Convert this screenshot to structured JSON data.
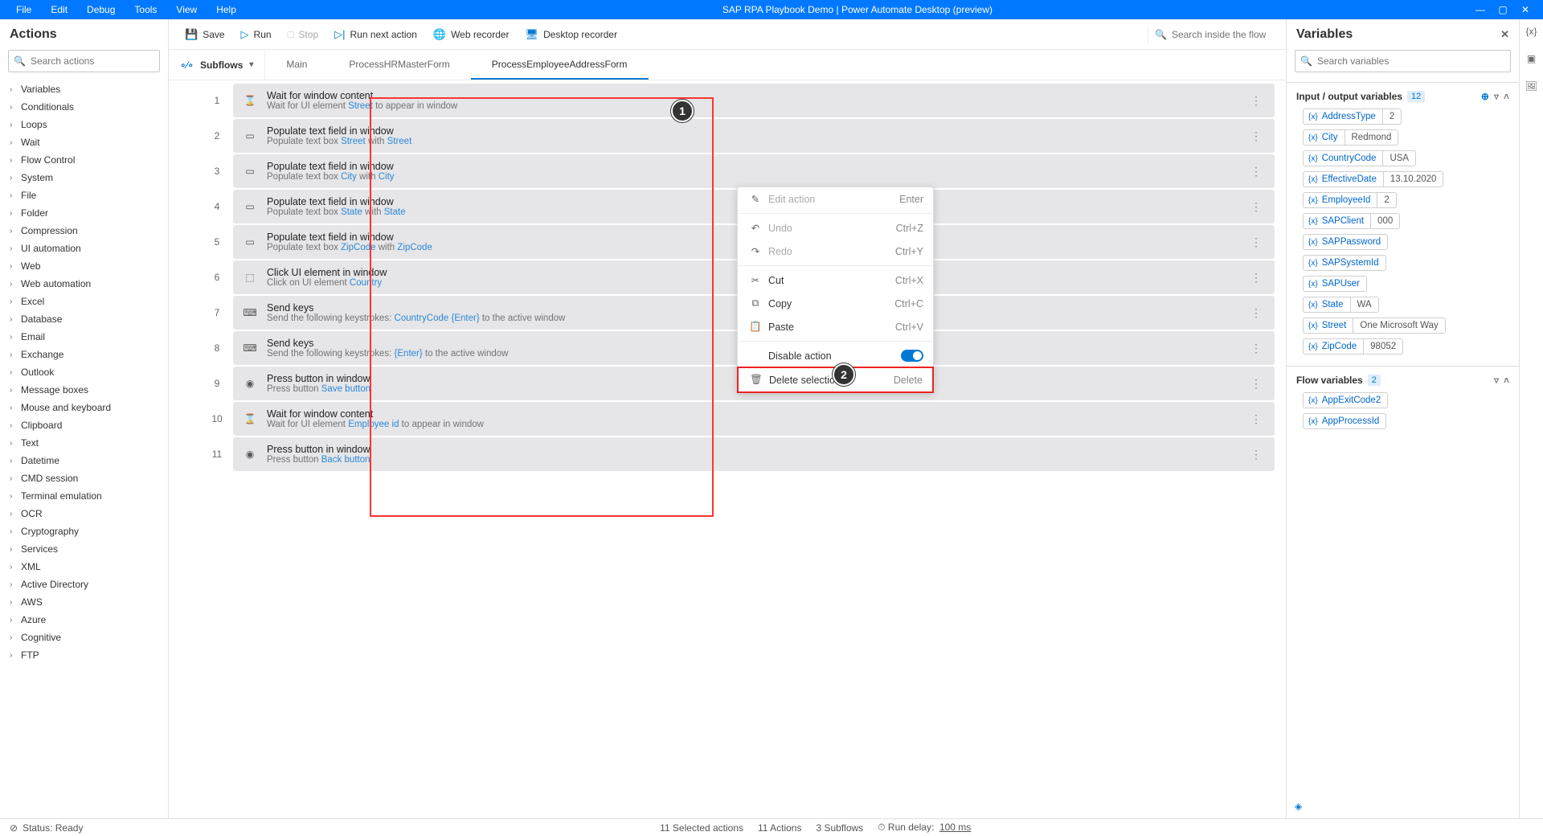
{
  "menu": {
    "file": "File",
    "edit": "Edit",
    "debug": "Debug",
    "tools": "Tools",
    "view": "View",
    "help": "Help"
  },
  "appTitle": "SAP RPA Playbook Demo | Power Automate Desktop (preview)",
  "panels": {
    "actions": "Actions",
    "variables": "Variables"
  },
  "search": {
    "actions_ph": "Search actions",
    "flow_ph": "Search inside the flow",
    "vars_ph": "Search variables"
  },
  "categories": [
    "Variables",
    "Conditionals",
    "Loops",
    "Wait",
    "Flow Control",
    "System",
    "File",
    "Folder",
    "Compression",
    "UI automation",
    "Web",
    "Web automation",
    "Excel",
    "Database",
    "Email",
    "Exchange",
    "Outlook",
    "Message boxes",
    "Mouse and keyboard",
    "Clipboard",
    "Text",
    "Datetime",
    "CMD session",
    "Terminal emulation",
    "OCR",
    "Cryptography",
    "Services",
    "XML",
    "Active Directory",
    "AWS",
    "Azure",
    "Cognitive",
    "FTP"
  ],
  "toolbar": {
    "save": "Save",
    "run": "Run",
    "stop": "Stop",
    "runNext": "Run next action",
    "webRec": "Web recorder",
    "deskRec": "Desktop recorder"
  },
  "tabs": {
    "subflows": "Subflows",
    "main": "Main",
    "t2": "ProcessHRMasterForm",
    "t3": "ProcessEmployeeAddressForm"
  },
  "steps": [
    {
      "n": "1",
      "icon": "⌛",
      "title": "Wait for window content",
      "d1": "Wait for UI element ",
      "l1": "Street",
      "d2": " to appear in window"
    },
    {
      "n": "2",
      "icon": "▭",
      "title": "Populate text field in window",
      "d1": "Populate text box ",
      "l1": "Street",
      "d2": " with   ",
      "l2": "Street"
    },
    {
      "n": "3",
      "icon": "▭",
      "title": "Populate text field in window",
      "d1": "Populate text box ",
      "l1": "City",
      "d2": " with   ",
      "l2": "City"
    },
    {
      "n": "4",
      "icon": "▭",
      "title": "Populate text field in window",
      "d1": "Populate text box ",
      "l1": "State",
      "d2": " with   ",
      "l2": "State"
    },
    {
      "n": "5",
      "icon": "▭",
      "title": "Populate text field in window",
      "d1": "Populate text box ",
      "l1": "ZipCode",
      "d2": " with   ",
      "l2": "ZipCode"
    },
    {
      "n": "6",
      "icon": "⬚",
      "title": "Click UI element in window",
      "d1": "Click on UI element ",
      "l1": "Country"
    },
    {
      "n": "7",
      "icon": "⌨",
      "title": "Send keys",
      "d1": "Send the following keystrokes:   ",
      "l1": "CountryCode",
      "d2": "   ",
      "l2": "{Enter}",
      "d3": " to the active window"
    },
    {
      "n": "8",
      "icon": "⌨",
      "title": "Send keys",
      "d1": "Send the following keystrokes: ",
      "l1": "{Enter}",
      "d2": " to the active window"
    },
    {
      "n": "9",
      "icon": "◉",
      "title": "Press button in window",
      "d1": "Press button ",
      "l1": "Save button"
    },
    {
      "n": "10",
      "icon": "⌛",
      "title": "Wait for window content",
      "d1": "Wait for UI element ",
      "l1": "Employee id",
      "d2": " to appear in window"
    },
    {
      "n": "11",
      "icon": "◉",
      "title": "Press button in window",
      "d1": "Press button ",
      "l1": "Back button"
    }
  ],
  "context": {
    "edit": "Edit action",
    "edit_k": "Enter",
    "undo": "Undo",
    "undo_k": "Ctrl+Z",
    "redo": "Redo",
    "redo_k": "Ctrl+Y",
    "cut": "Cut",
    "cut_k": "Ctrl+X",
    "copy": "Copy",
    "copy_k": "Ctrl+C",
    "paste": "Paste",
    "paste_k": "Ctrl+V",
    "disable": "Disable action",
    "delete": "Delete selection",
    "delete_k": "Delete"
  },
  "io": {
    "header": "Input / output variables",
    "count": "12"
  },
  "ioVars": [
    {
      "n": "AddressType",
      "v": "2"
    },
    {
      "n": "City",
      "v": "Redmond"
    },
    {
      "n": "CountryCode",
      "v": "USA"
    },
    {
      "n": "EffectiveDate",
      "v": "13.10.2020"
    },
    {
      "n": "EmployeeId",
      "v": "2"
    },
    {
      "n": "SAPClient",
      "v": "000"
    },
    {
      "n": "SAPPassword",
      "v": ""
    },
    {
      "n": "SAPSystemId",
      "v": ""
    },
    {
      "n": "SAPUser",
      "v": ""
    },
    {
      "n": "State",
      "v": "WA"
    },
    {
      "n": "Street",
      "v": "One Microsoft Way"
    },
    {
      "n": "ZipCode",
      "v": "98052"
    }
  ],
  "flowv": {
    "header": "Flow variables",
    "count": "2"
  },
  "flowVars": [
    {
      "n": "AppExitCode2",
      "v": ""
    },
    {
      "n": "AppProcessId",
      "v": ""
    }
  ],
  "status": {
    "ready": "Status: Ready",
    "sel": "11 Selected actions",
    "act": "11 Actions",
    "sub": "3 Subflows",
    "delay": "Run delay:",
    "delayv": "100 ms"
  },
  "callouts": {
    "c1": "1",
    "c2": "2"
  }
}
